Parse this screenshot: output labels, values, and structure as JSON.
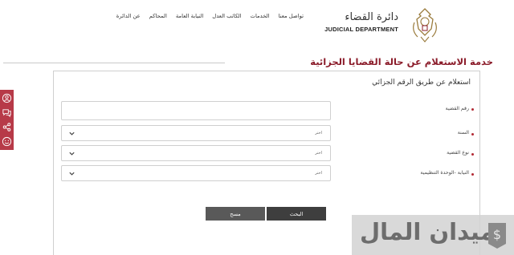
{
  "header": {
    "brand_ar": "دائرة القضاء",
    "brand_en": "JUDICIAL DEPARTMENT",
    "nav": [
      "عن الدائرة",
      "المحاكم",
      "النيابة العامة",
      "الكاتب العدل",
      "الخدمات",
      "تواصل معنا"
    ]
  },
  "page_title": "خدمة الاستعلام عن حالة القضايا الجزائية",
  "form": {
    "heading": "استعلام عن طريق الرقم الجزائي",
    "fields": [
      {
        "label": "رقم القضية",
        "value": ""
      },
      {
        "label": "السنة",
        "value": "اختر"
      },
      {
        "label": "نوع القضية",
        "value": "اختر"
      },
      {
        "label": "النيابة -الوحدة التنظيمية",
        "value": "اختر"
      }
    ],
    "search_label": "البحث",
    "clear_label": "مسح"
  },
  "sidebar": {
    "icons": [
      "user-icon",
      "chat-icon",
      "share-icon",
      "smiley-icon"
    ]
  },
  "watermark": {
    "text": "ميدان المال"
  },
  "colors": {
    "accent": "#8b1c2a",
    "sidebar": "#b73a48",
    "button_dark": "#3e3e3e",
    "button_gray": "#595959"
  }
}
